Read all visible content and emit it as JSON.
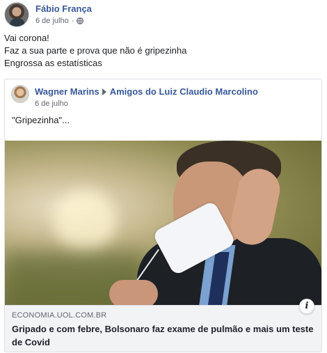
{
  "post": {
    "author": "Fábio França",
    "date": "6 de julho",
    "privacy_icon": "globe-icon",
    "lines": [
      "Vai corona!",
      "Faz a sua parte e prova que não é gripezinha",
      "Engrossa as estatísticas"
    ]
  },
  "shared_post": {
    "author": "Wagner Marins",
    "arrow_icon": "right-triangle-icon",
    "group": "Amigos do Luiz Claudio Marcolino",
    "date": "6 de julho",
    "text": "\"Gripezinha\"..."
  },
  "link_preview": {
    "domain": "ECONOMIA.UOL.COM.BR",
    "title": "Gripado e com febre, Bolsonaro faz exame de pulmão e mais um teste de Covid",
    "info_label": "i"
  }
}
